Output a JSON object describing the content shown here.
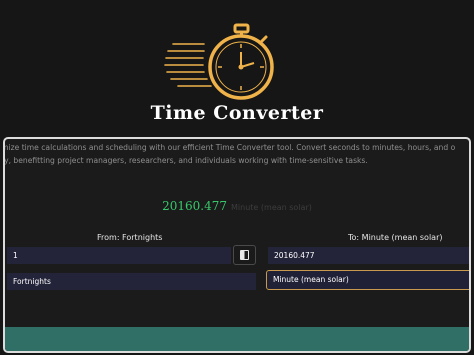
{
  "header": {
    "title": "Time Converter",
    "icon": "stopwatch-icon",
    "accent_color": "#f0b34a"
  },
  "description": {
    "line1": "imize time calculations and scheduling with our efficient Time Converter tool. Convert seconds to minutes, hours, and o",
    "line2": "tly, benefitting project managers, researchers, and individuals working with time-sensitive tasks."
  },
  "result": {
    "value": "20160.477",
    "unit": "Minute (mean solar)",
    "value_color": "#36c96a"
  },
  "from": {
    "label": "From:  Fortnights",
    "value": "1",
    "unit": "Fortnights"
  },
  "to": {
    "label": "To:  Minute (mean solar)",
    "value": "20160.477",
    "unit": "Minute (mean solar)"
  },
  "swap": {
    "icon": "copy-icon"
  },
  "colors": {
    "background": "#161616",
    "field": "#23233a",
    "highlight_border": "#c99a4e",
    "footer": "#2f6f66"
  }
}
